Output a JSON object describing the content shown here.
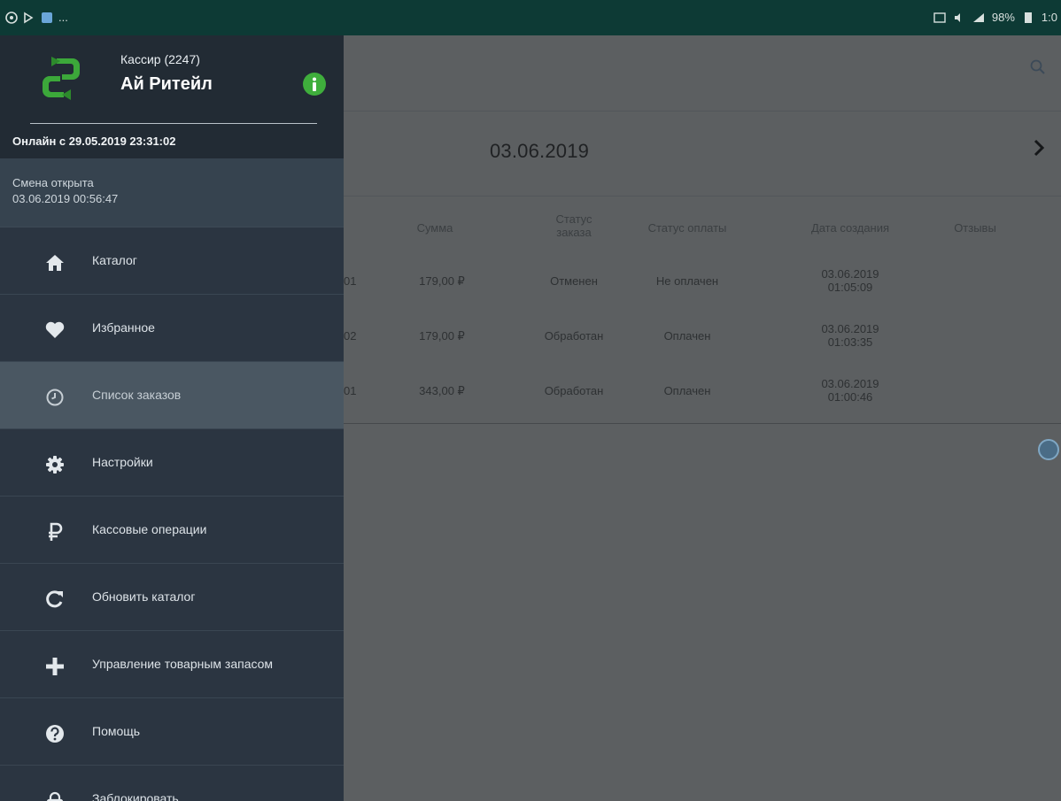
{
  "status_bar": {
    "left_text": "...",
    "battery": "98%",
    "time": "1:0"
  },
  "drawer": {
    "role": "Кассир (2247)",
    "company": "Ай Ритейл",
    "online": "Онлайн с 29.05.2019 23:31:02",
    "shift_label": "Смена открыта",
    "shift_time": "03.06.2019 00:56:47",
    "menu": [
      {
        "label": "Каталог",
        "icon": "home-icon"
      },
      {
        "label": "Избранное",
        "icon": "heart-icon"
      },
      {
        "label": "Список заказов",
        "icon": "clock-icon",
        "active": true
      },
      {
        "label": "Настройки",
        "icon": "gear-icon"
      },
      {
        "label": "Кассовые операции",
        "icon": "ruble-icon"
      },
      {
        "label": "Обновить каталог",
        "icon": "refresh-icon"
      },
      {
        "label": "Управление товарным запасом",
        "icon": "plus-icon"
      },
      {
        "label": "Помощь",
        "icon": "help-icon"
      },
      {
        "label": "Заблокировать",
        "icon": "lock-icon"
      }
    ]
  },
  "main": {
    "date": "03.06.2019",
    "table": {
      "headers": {
        "sum": "Сумма",
        "status_line1": "Статус",
        "status_line2": "заказа",
        "pay_status": "Статус оплаты",
        "created": "Дата создания",
        "reviews": "Отзывы"
      },
      "rows": [
        {
          "id": "01",
          "sum": "179,00 ₽",
          "status": "Отменен",
          "pay": "Не оплачен",
          "date": "03.06.2019",
          "time": "01:05:09"
        },
        {
          "id": "02",
          "sum": "179,00 ₽",
          "status": "Обработан",
          "pay": "Оплачен",
          "date": "03.06.2019",
          "time": "01:03:35"
        },
        {
          "id": "01",
          "sum": "343,00 ₽",
          "status": "Обработан",
          "pay": "Оплачен",
          "date": "03.06.2019",
          "time": "01:00:46"
        }
      ]
    }
  },
  "colors": {
    "drawer_bg": "#2b3541",
    "drawer_header_bg": "#222b34",
    "active_item_bg": "#4a5762",
    "status_bar_bg": "#0d3a35",
    "info_green": "#3fae3c",
    "logo_green": "#3ca83a"
  }
}
